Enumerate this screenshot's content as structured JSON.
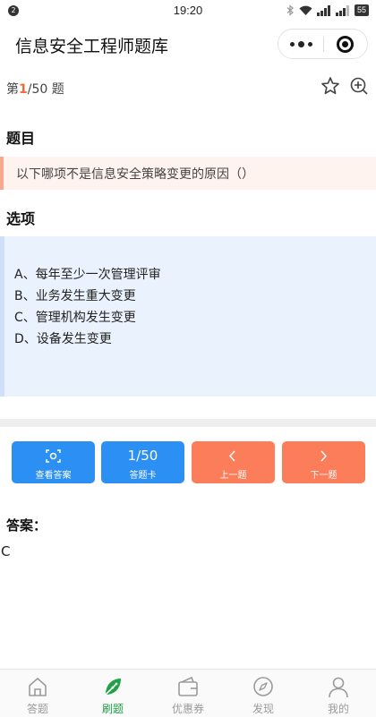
{
  "status_bar": {
    "notification_count": "2",
    "time": "19:20",
    "battery": "55"
  },
  "nav": {
    "title": "信息安全工程师题库"
  },
  "counter": {
    "prefix": "第",
    "current": "1",
    "total_text": "/50 题"
  },
  "question": {
    "section_title": "题目",
    "text": "以下哪项不是信息安全策略变更的原因（）"
  },
  "options": {
    "section_title": "选项",
    "items": [
      "A、每年至少一次管理评审",
      "B、业务发生重大变更",
      "C、管理机构发生变更",
      "D、设备发生变更"
    ]
  },
  "buttons": {
    "view_answer": "查看答案",
    "card_count": "1/50",
    "card_label": "答题卡",
    "prev": "上一题",
    "next": "下一题"
  },
  "answer": {
    "title": "答案：",
    "value": "C"
  },
  "tabs": [
    {
      "label": "答题",
      "icon": "home-icon",
      "active": false
    },
    {
      "label": "刷题",
      "icon": "leaf-icon",
      "active": true
    },
    {
      "label": "优惠券",
      "icon": "wallet-icon",
      "active": false
    },
    {
      "label": "发现",
      "icon": "compass-icon",
      "active": false
    },
    {
      "label": "我的",
      "icon": "user-icon",
      "active": false
    }
  ],
  "colors": {
    "accent_orange": "#fb7d5a",
    "accent_blue": "#2c8ff3",
    "tab_active": "#22a045"
  }
}
